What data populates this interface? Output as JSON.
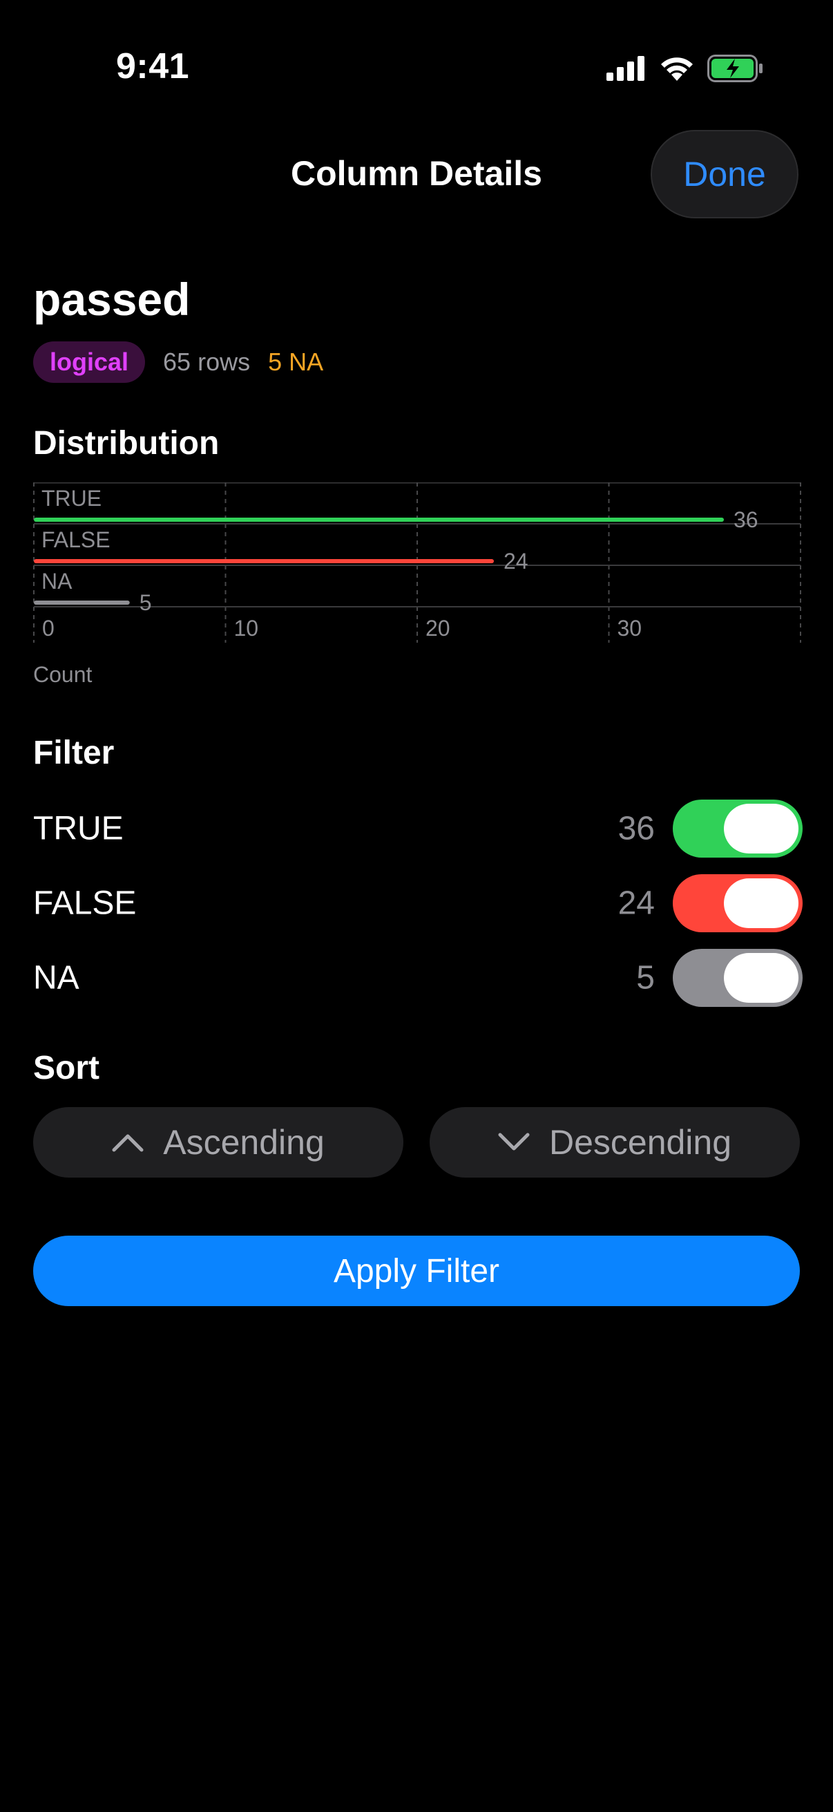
{
  "status_bar": {
    "time": "9:41",
    "icons": [
      "cellular-signal-icon",
      "wifi-icon",
      "battery-charging-icon"
    ]
  },
  "header": {
    "title": "Column Details",
    "done_label": "Done"
  },
  "column": {
    "name": "passed",
    "type_badge": "logical",
    "rows": "65 rows",
    "na": "5 NA"
  },
  "distribution": {
    "title": "Distribution",
    "axis_label": "Count"
  },
  "chart_data": {
    "type": "bar",
    "orientation": "horizontal",
    "categories": [
      "TRUE",
      "FALSE",
      "NA"
    ],
    "values": [
      36,
      24,
      5
    ],
    "colors": [
      "#30d158",
      "#ff453a",
      "#8e8e93"
    ],
    "xlabel": "Count",
    "xlim": [
      0,
      40
    ],
    "xticks": [
      0,
      10,
      20,
      30
    ],
    "grid": true
  },
  "filter": {
    "title": "Filter",
    "items": [
      {
        "label": "TRUE",
        "count": "36",
        "color": "#30d158",
        "on": true
      },
      {
        "label": "FALSE",
        "count": "24",
        "color": "#ff453a",
        "on": true
      },
      {
        "label": "NA",
        "count": "5",
        "color": "#8e8e93",
        "on": true
      }
    ]
  },
  "sort": {
    "title": "Sort",
    "ascending_label": "Ascending",
    "descending_label": "Descending"
  },
  "apply_label": "Apply Filter"
}
